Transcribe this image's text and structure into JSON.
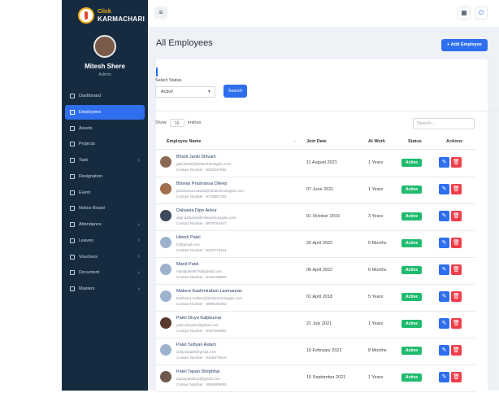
{
  "brand": {
    "top": "Click",
    "bottom": "KARMACHARI"
  },
  "profile": {
    "name": "Mitesh Shere",
    "role": "Admin"
  },
  "sidebar": {
    "items": [
      {
        "label": "Dashboard",
        "icon": "home-icon",
        "has_submenu": false,
        "active": false
      },
      {
        "label": "Employees",
        "icon": "users-icon",
        "has_submenu": false,
        "active": true
      },
      {
        "label": "Assets",
        "icon": "box-icon",
        "has_submenu": false,
        "active": false
      },
      {
        "label": "Projects",
        "icon": "folder-icon",
        "has_submenu": false,
        "active": false
      },
      {
        "label": "Task",
        "icon": "task-icon",
        "has_submenu": true,
        "active": false
      },
      {
        "label": "Resignation",
        "icon": "resignation-icon",
        "has_submenu": false,
        "active": false
      },
      {
        "label": "Event",
        "icon": "event-icon",
        "has_submenu": false,
        "active": false
      },
      {
        "label": "Notice Board",
        "icon": "notice-icon",
        "has_submenu": false,
        "active": false
      },
      {
        "label": "Attendance",
        "icon": "calendar-icon",
        "has_submenu": true,
        "active": false
      },
      {
        "label": "Leaves",
        "icon": "leave-icon",
        "has_submenu": true,
        "active": false
      },
      {
        "label": "Vouchers",
        "icon": "voucher-icon",
        "has_submenu": true,
        "active": false
      },
      {
        "label": "Document",
        "icon": "document-icon",
        "has_submenu": true,
        "active": false
      },
      {
        "label": "Masters",
        "icon": "masters-icon",
        "has_submenu": true,
        "active": false
      }
    ]
  },
  "header": {
    "menu_icon": "≡",
    "hierarchy_icon": "▦",
    "power_icon": "⏻"
  },
  "page": {
    "title": "All Employees",
    "add_button": "+ Add Employee"
  },
  "filter": {
    "status_label": "Select Status",
    "status_value": "Active",
    "search_button": "Search"
  },
  "table_controls": {
    "show_prefix": "Show",
    "show_value": "10",
    "show_suffix": "entries",
    "search_placeholder": "Search..."
  },
  "table": {
    "columns": [
      "Employee Name",
      "Join Date",
      "At Work",
      "Status",
      "Actions"
    ],
    "rows": [
      {
        "name": "Bharti Janki Shivam",
        "email": "jaiki.bharti@infotechnologies.com",
        "contact": "Contact Number : 8200347592",
        "join_date": "11 August 2021",
        "at_work": "1 Years",
        "status": "Active",
        "avatar_color": "#8a6a56"
      },
      {
        "name": "Biswas Prashansa Dileep",
        "email": "prashansa.biswas@infotechnologies.com",
        "contact": "Contact Number : 9723807193",
        "join_date": "07 June 2021",
        "at_work": "1 Years",
        "status": "Active",
        "avatar_color": "#a0704c"
      },
      {
        "name": "Dalsania Dipe Ankur",
        "email": "dipe.dalsania@infotechnologies.com",
        "contact": "Contact Number : 9979794447",
        "join_date": "01 October 2019",
        "at_work": "3 Years",
        "status": "Active",
        "avatar_color": "#3d4a5a"
      },
      {
        "name": "Hitesh Patel",
        "email": "ht@gmail.com",
        "contact": "Contact Number : 9303775124",
        "join_date": "26 April 2022",
        "at_work": "5 Months",
        "status": "Active",
        "avatar_color": "#9db3cc"
      },
      {
        "name": "Manit Patel",
        "email": "manitpatel0078@gmail.com",
        "contact": "Contact Number : 9104159680",
        "join_date": "06 April 2022",
        "at_work": "6 Months",
        "status": "Active",
        "avatar_color": "#9db3cc"
      },
      {
        "name": "Makers Kashmiraben Laxmanrao",
        "email": "kashmira.makers@infotechnologies.com",
        "contact": "Contact Number : 9909198303",
        "join_date": "01 April 2018",
        "at_work": "5 Years",
        "status": "Active",
        "avatar_color": "#9db3cc"
      },
      {
        "name": "Patel Divya Kalpkumar",
        "email": "patel.divya01@gmail.com",
        "contact": "Contact Number : 8487948091",
        "join_date": "21 July 2021",
        "at_work": "1 Years",
        "status": "Active",
        "avatar_color": "#5a3a2e"
      },
      {
        "name": "Patel Sufiyan Aslam",
        "email": "sufiyanpatel@gmail.com",
        "contact": "Contact Number : 9426079016",
        "join_date": "16 February 2022",
        "at_work": "8 Months",
        "status": "Active",
        "avatar_color": "#9db3cc"
      },
      {
        "name": "Patel Tapan Shilpbhai",
        "email": "tapanpatel613@gmail.com",
        "contact": "Contact Number : 9558809893",
        "join_date": "15 September 2021",
        "at_work": "1 Years",
        "status": "Active",
        "avatar_color": "#6e5a4c"
      }
    ]
  },
  "colors": {
    "sidebar_bg": "#172b40",
    "accent": "#2f6fed",
    "success": "#1fbb6e",
    "danger": "#ef3e4a"
  }
}
